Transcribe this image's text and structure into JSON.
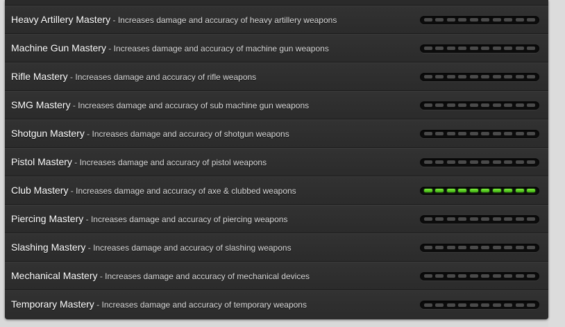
{
  "masteries": [
    {
      "name": "Heavy Artillery Mastery",
      "description": "Increases damage and accuracy of heavy artillery weapons",
      "level": 0
    },
    {
      "name": "Machine Gun Mastery",
      "description": "Increases damage and accuracy of machine gun weapons",
      "level": 0
    },
    {
      "name": "Rifle Mastery",
      "description": "Increases damage and accuracy of rifle weapons",
      "level": 0
    },
    {
      "name": "SMG Mastery",
      "description": "Increases damage and accuracy of sub machine gun weapons",
      "level": 0
    },
    {
      "name": "Shotgun Mastery",
      "description": "Increases damage and accuracy of shotgun weapons",
      "level": 0
    },
    {
      "name": "Pistol Mastery",
      "description": "Increases damage and accuracy of pistol weapons",
      "level": 0
    },
    {
      "name": "Club Mastery",
      "description": "Increases damage and accuracy of axe & clubbed weapons",
      "level": 10
    },
    {
      "name": "Piercing Mastery",
      "description": "Increases damage and accuracy of piercing weapons",
      "level": 0
    },
    {
      "name": "Slashing Mastery",
      "description": "Increases damage and accuracy of slashing weapons",
      "level": 0
    },
    {
      "name": "Mechanical Mastery",
      "description": "Increases damage and accuracy of mechanical devices",
      "level": 0
    },
    {
      "name": "Temporary Mastery",
      "description": "Increases damage and accuracy of temporary weapons",
      "level": 0
    }
  ],
  "max_level": 10,
  "separator": " - ",
  "colors": {
    "panel": "#2e2e2e",
    "segment_off": "#4a4a4a",
    "segment_on": "#5ad426"
  }
}
